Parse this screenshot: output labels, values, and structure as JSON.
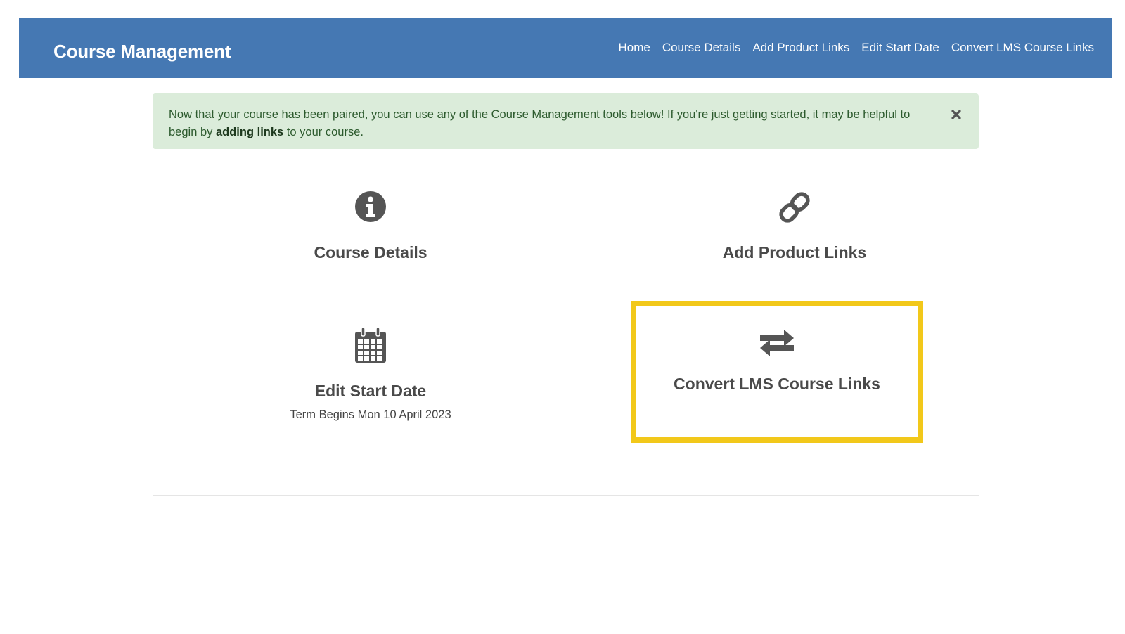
{
  "navbar": {
    "brand": "Course Management",
    "links": [
      "Home",
      "Course Details",
      "Add Product Links",
      "Edit Start Date",
      "Convert LMS Course Links"
    ]
  },
  "alert": {
    "text_before": "Now that your course has been paired, you can use any of the Course Management tools below! If you're just getting started, it may be helpful to begin by ",
    "bold_link": "adding links",
    "text_after": " to your course.",
    "close_icon": "close-icon"
  },
  "tiles": [
    {
      "icon": "info-circle-icon",
      "label": "Course Details"
    },
    {
      "icon": "link-icon",
      "label": "Add Product Links"
    },
    {
      "icon": "calendar-icon",
      "label": "Edit Start Date",
      "sub": "Term Begins Mon 10 April 2023"
    },
    {
      "icon": "exchange-arrows-icon",
      "label": "Convert LMS Course Links"
    }
  ],
  "colors": {
    "navbar": "#4578b3",
    "alert_bg": "#dbecda",
    "highlight": "#f2c81a",
    "icon": "#555555"
  }
}
